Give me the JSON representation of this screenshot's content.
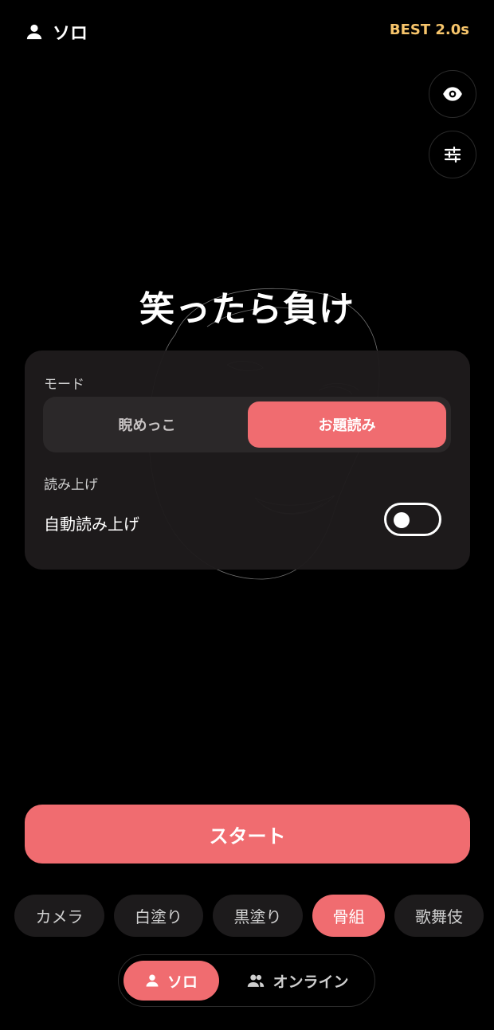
{
  "header": {
    "mode_label": "ソロ",
    "best_text": "BEST 2.0s",
    "icon": "person-icon"
  },
  "side_buttons": {
    "eye": "eye-icon",
    "settings": "sliders-icon"
  },
  "title": "笑ったら負け",
  "panel": {
    "mode_label": "モード",
    "mode_options": [
      "睨めっこ",
      "お題読み"
    ],
    "mode_selected": "お題読み",
    "read_label": "読み上げ",
    "auto_read_label": "自動読み上げ",
    "auto_read_enabled": false
  },
  "start_label": "スタート",
  "filters": [
    "カメラ",
    "白塗り",
    "黒塗り",
    "骨組",
    "歌舞伎"
  ],
  "filter_selected": "骨組",
  "bottom_nav": {
    "solo": "ソロ",
    "online": "オンライン",
    "selected": "ソロ"
  },
  "colors": {
    "accent": "#f06c70",
    "best": "#f7c56b",
    "panel": "#1e1b1c"
  }
}
